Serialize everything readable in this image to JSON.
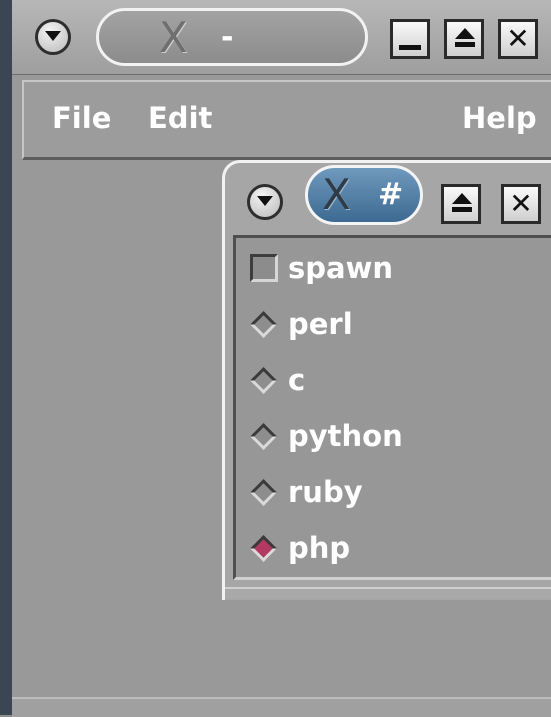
{
  "main_window": {
    "title_logo": "X",
    "title": "-",
    "buttons": [
      "window-menu",
      "minimize",
      "maximize",
      "close"
    ]
  },
  "menubar": {
    "items": [
      "File",
      "Edit",
      "Help"
    ]
  },
  "child_window": {
    "title_logo": "X",
    "title": "#",
    "buttons": [
      "window-menu",
      "maximize",
      "close"
    ],
    "checkbox": {
      "label": "spawn",
      "checked": false
    },
    "radio_options": [
      {
        "label": "perl",
        "selected": false
      },
      {
        "label": "c",
        "selected": false
      },
      {
        "label": "python",
        "selected": false
      },
      {
        "label": "ruby",
        "selected": false
      },
      {
        "label": "php",
        "selected": true
      }
    ],
    "radio_selected_color": "#b23a62"
  },
  "colors": {
    "window_bg": "#999999",
    "active_title_pill": "#4f7ba3",
    "inactive_title_pill": "#999999"
  }
}
